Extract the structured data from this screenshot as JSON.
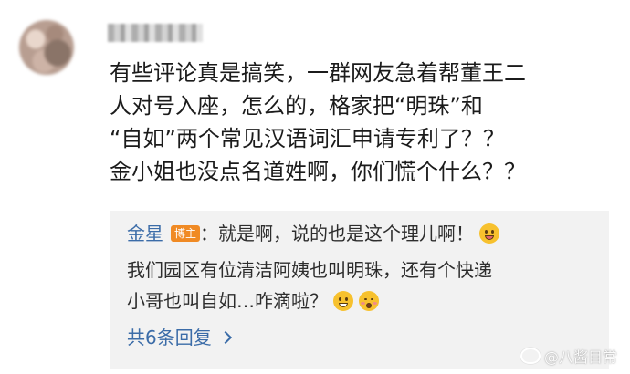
{
  "comment": {
    "text": "有些评论真是搞笑，一群网友急着帮董王二\n人对号入座，怎么的，格家把“明珠”和\n“自如”两个常见汉语词汇申请专利了？？\n金小姐也没点名道姓啊，你们慌个什么？？"
  },
  "reply": {
    "author": "金星",
    "badge": "博主",
    "separator": "：",
    "line1": "就是啊，说的也是这个理儿啊！",
    "line2": "我们园区有位清洁阿姨也叫明珠，还有个快递",
    "line3": "小哥也叫自如…咋滴啦？",
    "emoji_1": "grinning-wink-emoji",
    "emoji_2": "grin-emoji",
    "emoji_3": "blush-emoji"
  },
  "total_replies": "共6条回复",
  "watermark": "@八酱目常",
  "colors": {
    "link": "#3b6ca8",
    "badge": "#f08a24",
    "reply_bg": "#f2f2f2",
    "text": "#1b1b1b"
  }
}
